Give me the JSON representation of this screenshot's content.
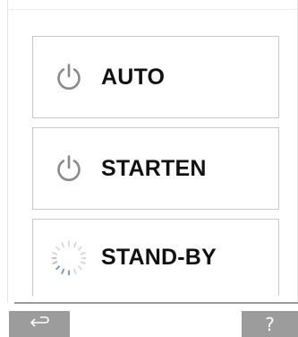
{
  "modes": [
    {
      "id": "auto",
      "label": "AUTO",
      "icon": "power-icon"
    },
    {
      "id": "start",
      "label": "STARTEN",
      "icon": "power-icon"
    },
    {
      "id": "standby",
      "label": "STAND-BY",
      "icon": "loading-spinner-icon"
    }
  ],
  "footer": {
    "back_icon": "back-arrow-icon",
    "help_label": "?"
  },
  "colors": {
    "button_border": "#c9c9c9",
    "footer_button": "#9c9c9c",
    "icon_gray": "#8a8a8a",
    "spinner_blue": "#6f8fc4"
  }
}
